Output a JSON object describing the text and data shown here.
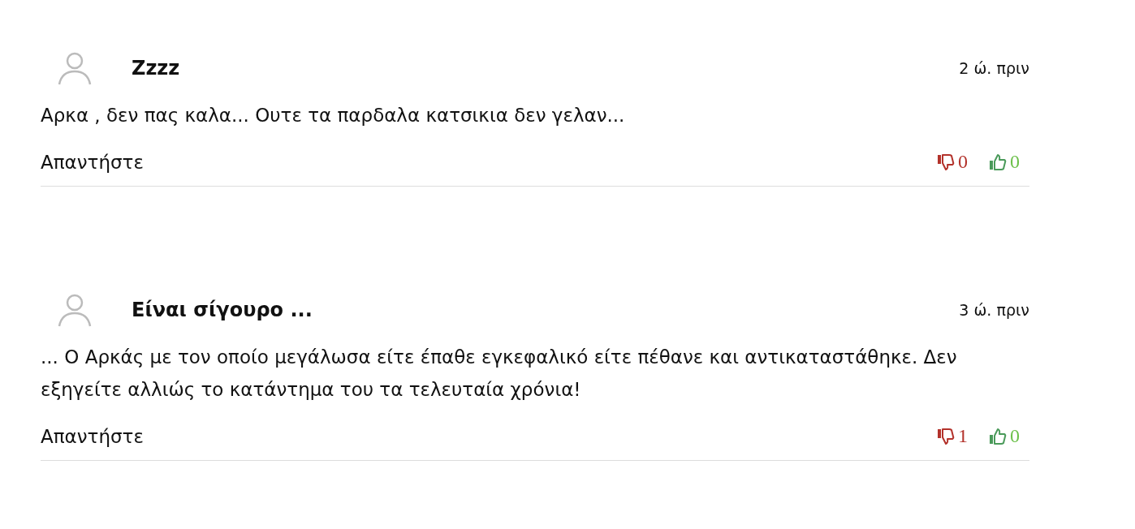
{
  "comments": [
    {
      "author": "Zzzz",
      "time": "2 ώ. πριν",
      "text": "Αρκα , δεν πας καλα... Ουτε τα παρδαλα κατσικια δεν γελαν...",
      "reply": "Απαντήστε",
      "dislikes": "0",
      "likes": "0"
    },
    {
      "author": "Είναι σίγουρο ...",
      "time": "3 ώ. πριν",
      "text": "... Ο Αρκάς με τον οποίο μεγάλωσα είτε έπαθε εγκεφαλικό είτε πέθανε και αντικαταστάθηκε. Δεν εξηγείτε αλλιώς το κατάντημα του τα τελευταία χρόνια!",
      "reply": "Απαντήστε",
      "dislikes": "1",
      "likes": "0"
    }
  ]
}
